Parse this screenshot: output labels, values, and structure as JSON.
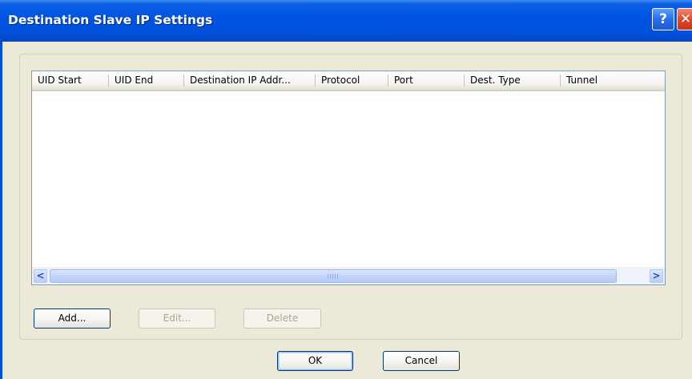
{
  "window": {
    "title": "Destination Slave IP Settings",
    "help_glyph": "?",
    "close_glyph": "✕"
  },
  "listview": {
    "columns": [
      {
        "label": "UID Start"
      },
      {
        "label": "UID End"
      },
      {
        "label": "Destination IP Addr..."
      },
      {
        "label": "Protocol"
      },
      {
        "label": "Port"
      },
      {
        "label": "Dest. Type"
      },
      {
        "label": "Tunnel"
      }
    ],
    "rows": [],
    "scroll_left_glyph": "<",
    "scroll_right_glyph": ">"
  },
  "buttons": {
    "add": "Add...",
    "edit": "Edit...",
    "delete": "Delete",
    "ok": "OK",
    "cancel": "Cancel"
  },
  "colors": {
    "titlebar": "#0054e3",
    "dialog_bg": "#ece9d8",
    "list_border": "#7f9db9",
    "disabled_text": "#a8a69a"
  }
}
